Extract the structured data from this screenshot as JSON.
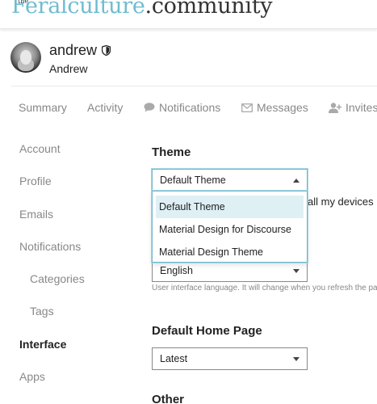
{
  "header": {
    "logo_prefix": "the",
    "logo_part1": "Feralculture",
    "logo_part2": ".community"
  },
  "user": {
    "username": "andrew",
    "full_name": "Andrew"
  },
  "nav_tabs": [
    {
      "label": "Summary",
      "icon": ""
    },
    {
      "label": "Activity",
      "icon": ""
    },
    {
      "label": "Notifications",
      "icon": "comment-icon"
    },
    {
      "label": "Messages",
      "icon": "envelope-icon"
    },
    {
      "label": "Invites",
      "icon": "user-plus-icon"
    }
  ],
  "side_nav": [
    {
      "label": "Account"
    },
    {
      "label": "Profile"
    },
    {
      "label": "Emails"
    },
    {
      "label": "Notifications"
    },
    {
      "label": "Categories"
    },
    {
      "label": "Tags"
    },
    {
      "label": "Interface",
      "active": true
    },
    {
      "label": "Apps"
    }
  ],
  "theme": {
    "heading": "Theme",
    "selected": "Default Theme",
    "options": [
      "Default Theme",
      "Material Design for Discourse",
      "Material Design Theme"
    ],
    "devices_text": "all my devices"
  },
  "language": {
    "selected": "English",
    "help": "User interface language. It will change when you refresh the page."
  },
  "home_page": {
    "heading": "Default Home Page",
    "selected": "Latest"
  },
  "other": {
    "heading": "Other"
  },
  "colors": {
    "accent": "#6fbcd0",
    "focus_border": "#71b7cc",
    "selected_option_bg": "#dff0f5",
    "muted_text": "#888888"
  }
}
